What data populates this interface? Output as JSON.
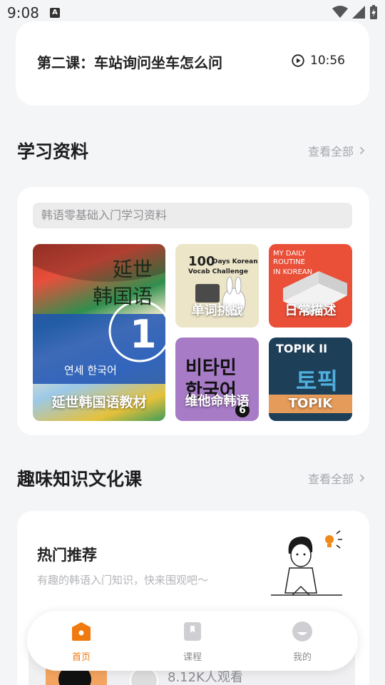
{
  "status_bar": {
    "time": "9:08",
    "notification_badge": "A"
  },
  "lesson": {
    "title": "第二课：车站询问坐车怎么问",
    "duration": "10:56"
  },
  "materials": {
    "section_title": "学习资料",
    "see_all": "查看全部",
    "search_placeholder": "韩语零基础入门学习资料",
    "books": [
      {
        "label": "延世韩国语教材",
        "cover_text_1": "延世",
        "cover_text_2": "韩国语",
        "cover_number": "1",
        "cover_korean": "연세 한국어"
      },
      {
        "label": "单词挑战",
        "cover_text_1": "100",
        "cover_text_2": "Days Korean",
        "cover_text_3": "Vocab Challenge"
      },
      {
        "label": "日常描述",
        "cover_text_1": "MY DAILY ROUTINE",
        "cover_text_2": "IN KOREAN"
      },
      {
        "label": "维他命韩语",
        "cover_text_1": "비타민",
        "cover_text_2": "한국어",
        "cover_number": "6"
      },
      {
        "label": "TOPIK",
        "cover_text_1": "TOPIK II",
        "cover_text_2": "토픽"
      }
    ]
  },
  "fun_section": {
    "section_title": "趣味知识文化课",
    "see_all": "查看全部",
    "hot_title": "热门推荐",
    "hot_subtitle": "有趣的韩语入门知识，快来围观吧～",
    "views": "8.12K人观看"
  },
  "nav": {
    "items": [
      {
        "label": "首页",
        "icon": "home-icon",
        "active": true
      },
      {
        "label": "课程",
        "icon": "bookmark-icon",
        "active": false
      },
      {
        "label": "我的",
        "icon": "profile-icon",
        "active": false
      }
    ]
  },
  "colors": {
    "accent": "#f07a10",
    "background": "#f4f5f7"
  }
}
